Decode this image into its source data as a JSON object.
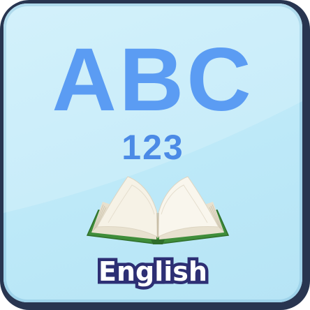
{
  "icon": {
    "headline": "ABC",
    "numbers": "123",
    "label": "English",
    "symbol": "open-book-icon",
    "colors": {
      "frame": "#283550",
      "background": "#c4ecf9",
      "letters": "#5b9cf3",
      "label_fill": "#ffffff",
      "label_outline": "#2d2f74",
      "book_cover": "#3f8d3a"
    }
  }
}
